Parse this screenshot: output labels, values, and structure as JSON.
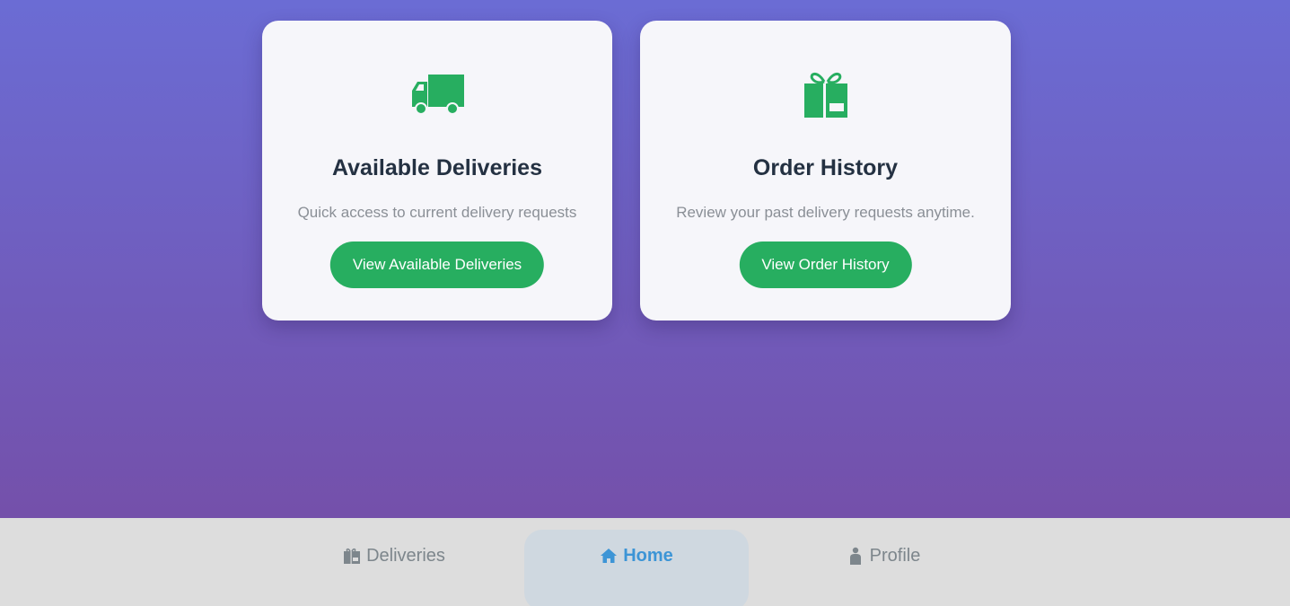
{
  "colors": {
    "accent_green": "#27ae60",
    "gradient_top": "#6b6cd4",
    "gradient_bottom": "#7450aa",
    "nav_active": "#3d95d6",
    "nav_inactive": "#7d868c"
  },
  "cards": [
    {
      "icon": "delivery-truck-icon",
      "title": "Available Deliveries",
      "description": "Quick access to current delivery requests",
      "button_label": "View Available Deliveries"
    },
    {
      "icon": "gift-box-icon",
      "title": "Order History",
      "description": "Review your past delivery requests anytime.",
      "button_label": "View Order History"
    }
  ],
  "bottom_nav": {
    "items": [
      {
        "icon": "package-icon",
        "label": "Deliveries",
        "active": false
      },
      {
        "icon": "home-icon",
        "label": "Home",
        "active": true
      },
      {
        "icon": "person-icon",
        "label": "Profile",
        "active": false
      }
    ]
  }
}
